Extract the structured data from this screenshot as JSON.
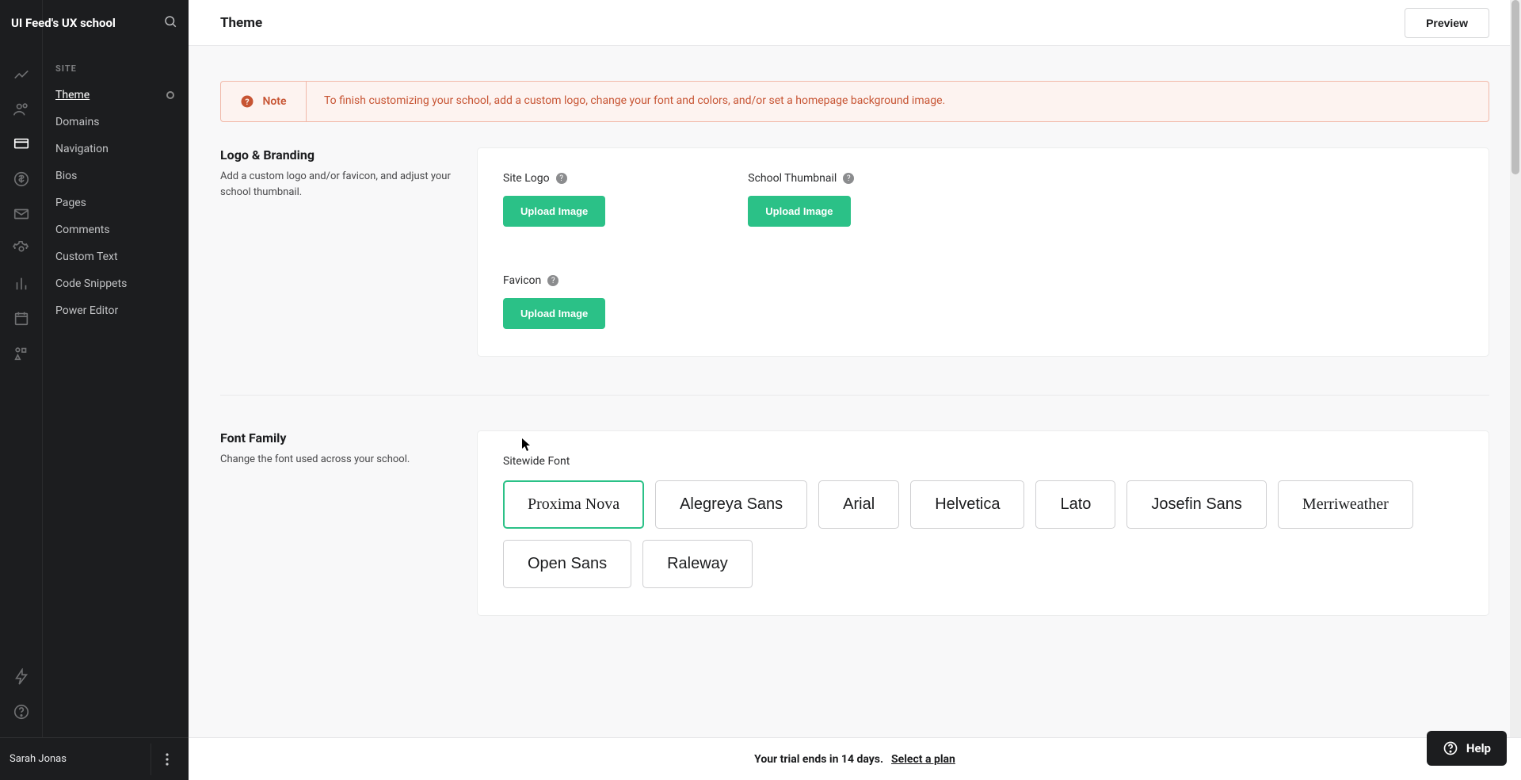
{
  "brand": "UI Feed's UX school",
  "page_title": "Theme",
  "preview_label": "Preview",
  "sidebar": {
    "section_label": "SITE",
    "items": [
      {
        "label": "Theme",
        "active": true,
        "has_dot": true
      },
      {
        "label": "Domains"
      },
      {
        "label": "Navigation"
      },
      {
        "label": "Bios"
      },
      {
        "label": "Pages"
      },
      {
        "label": "Comments"
      },
      {
        "label": "Custom Text"
      },
      {
        "label": "Code Snippets"
      },
      {
        "label": "Power Editor"
      }
    ]
  },
  "note": {
    "title": "Note",
    "body": "To finish customizing your school, add a custom logo, change your font and colors, and/or set a homepage background image."
  },
  "logo_section": {
    "heading": "Logo & Branding",
    "desc": "Add a custom logo and/or favicon, and adjust your school thumbnail.",
    "site_logo_label": "Site Logo",
    "school_thumb_label": "School Thumbnail",
    "favicon_label": "Favicon",
    "upload_label": "Upload Image"
  },
  "font_section": {
    "heading": "Font Family",
    "desc": "Change the font used across your school.",
    "sitewide_label": "Sitewide Font",
    "fonts": [
      {
        "name": "Proxima Nova",
        "selected": true,
        "css": "-apple-system"
      },
      {
        "name": "Alegreya Sans",
        "css": "sans-serif"
      },
      {
        "name": "Arial",
        "css": "Arial"
      },
      {
        "name": "Helvetica",
        "css": "Helvetica"
      },
      {
        "name": "Lato",
        "css": "sans-serif"
      },
      {
        "name": "Josefin Sans",
        "css": "sans-serif"
      },
      {
        "name": "Merriweather",
        "css": "serif"
      },
      {
        "name": "Open Sans",
        "css": "sans-serif"
      },
      {
        "name": "Raleway",
        "css": "sans-serif"
      }
    ]
  },
  "footer": {
    "user": "Sarah Jonas",
    "trial_msg": "Your trial ends in 14 days.",
    "select_plan": "Select a plan",
    "help": "Help"
  }
}
